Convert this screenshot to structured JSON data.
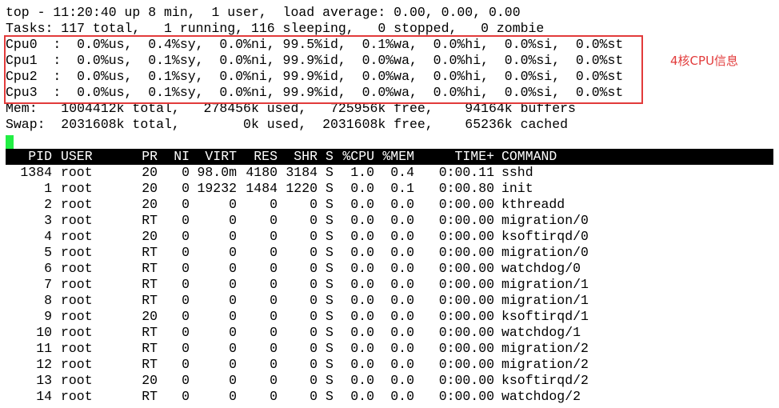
{
  "summary": {
    "top": "top - 11:20:40 up 8 min,  1 user,  load average: 0.00, 0.00, 0.00",
    "tasks": "Tasks: 117 total,   1 running, 116 sleeping,   0 stopped,   0 zombie",
    "cpus": [
      "Cpu0  :  0.0%us,  0.4%sy,  0.0%ni, 99.5%id,  0.1%wa,  0.0%hi,  0.0%si,  0.0%st",
      "Cpu1  :  0.0%us,  0.1%sy,  0.0%ni, 99.9%id,  0.0%wa,  0.0%hi,  0.0%si,  0.0%st",
      "Cpu2  :  0.0%us,  0.1%sy,  0.0%ni, 99.9%id,  0.0%wa,  0.0%hi,  0.0%si,  0.0%st",
      "Cpu3  :  0.0%us,  0.1%sy,  0.0%ni, 99.9%id,  0.0%wa,  0.0%hi,  0.0%si,  0.0%st"
    ],
    "mem": "Mem:   1004412k total,   278456k used,   725956k free,    94164k buffers",
    "swap": "Swap:  2031608k total,        0k used,  2031608k free,    65236k cached"
  },
  "annotation": {
    "text": "4核CPU信息",
    "color": "#e23b3b"
  },
  "columns": [
    "PID",
    "USER",
    "PR",
    "NI",
    "VIRT",
    "RES",
    "SHR",
    "S",
    "%CPU",
    "%MEM",
    "TIME+",
    "COMMAND"
  ],
  "processes": [
    {
      "pid": "1384",
      "user": "root",
      "pr": "20",
      "ni": "0",
      "virt": "98.0m",
      "res": "4180",
      "shr": "3184",
      "s": "S",
      "cpu": "1.0",
      "mem": "0.4",
      "time": "0:00.11",
      "cmd": "sshd"
    },
    {
      "pid": "1",
      "user": "root",
      "pr": "20",
      "ni": "0",
      "virt": "19232",
      "res": "1484",
      "shr": "1220",
      "s": "S",
      "cpu": "0.0",
      "mem": "0.1",
      "time": "0:00.80",
      "cmd": "init"
    },
    {
      "pid": "2",
      "user": "root",
      "pr": "20",
      "ni": "0",
      "virt": "0",
      "res": "0",
      "shr": "0",
      "s": "S",
      "cpu": "0.0",
      "mem": "0.0",
      "time": "0:00.00",
      "cmd": "kthreadd"
    },
    {
      "pid": "3",
      "user": "root",
      "pr": "RT",
      "ni": "0",
      "virt": "0",
      "res": "0",
      "shr": "0",
      "s": "S",
      "cpu": "0.0",
      "mem": "0.0",
      "time": "0:00.00",
      "cmd": "migration/0"
    },
    {
      "pid": "4",
      "user": "root",
      "pr": "20",
      "ni": "0",
      "virt": "0",
      "res": "0",
      "shr": "0",
      "s": "S",
      "cpu": "0.0",
      "mem": "0.0",
      "time": "0:00.00",
      "cmd": "ksoftirqd/0"
    },
    {
      "pid": "5",
      "user": "root",
      "pr": "RT",
      "ni": "0",
      "virt": "0",
      "res": "0",
      "shr": "0",
      "s": "S",
      "cpu": "0.0",
      "mem": "0.0",
      "time": "0:00.00",
      "cmd": "migration/0"
    },
    {
      "pid": "6",
      "user": "root",
      "pr": "RT",
      "ni": "0",
      "virt": "0",
      "res": "0",
      "shr": "0",
      "s": "S",
      "cpu": "0.0",
      "mem": "0.0",
      "time": "0:00.00",
      "cmd": "watchdog/0"
    },
    {
      "pid": "7",
      "user": "root",
      "pr": "RT",
      "ni": "0",
      "virt": "0",
      "res": "0",
      "shr": "0",
      "s": "S",
      "cpu": "0.0",
      "mem": "0.0",
      "time": "0:00.00",
      "cmd": "migration/1"
    },
    {
      "pid": "8",
      "user": "root",
      "pr": "RT",
      "ni": "0",
      "virt": "0",
      "res": "0",
      "shr": "0",
      "s": "S",
      "cpu": "0.0",
      "mem": "0.0",
      "time": "0:00.00",
      "cmd": "migration/1"
    },
    {
      "pid": "9",
      "user": "root",
      "pr": "20",
      "ni": "0",
      "virt": "0",
      "res": "0",
      "shr": "0",
      "s": "S",
      "cpu": "0.0",
      "mem": "0.0",
      "time": "0:00.00",
      "cmd": "ksoftirqd/1"
    },
    {
      "pid": "10",
      "user": "root",
      "pr": "RT",
      "ni": "0",
      "virt": "0",
      "res": "0",
      "shr": "0",
      "s": "S",
      "cpu": "0.0",
      "mem": "0.0",
      "time": "0:00.00",
      "cmd": "watchdog/1"
    },
    {
      "pid": "11",
      "user": "root",
      "pr": "RT",
      "ni": "0",
      "virt": "0",
      "res": "0",
      "shr": "0",
      "s": "S",
      "cpu": "0.0",
      "mem": "0.0",
      "time": "0:00.00",
      "cmd": "migration/2"
    },
    {
      "pid": "12",
      "user": "root",
      "pr": "RT",
      "ni": "0",
      "virt": "0",
      "res": "0",
      "shr": "0",
      "s": "S",
      "cpu": "0.0",
      "mem": "0.0",
      "time": "0:00.00",
      "cmd": "migration/2"
    },
    {
      "pid": "13",
      "user": "root",
      "pr": "20",
      "ni": "0",
      "virt": "0",
      "res": "0",
      "shr": "0",
      "s": "S",
      "cpu": "0.0",
      "mem": "0.0",
      "time": "0:00.00",
      "cmd": "ksoftirqd/2"
    },
    {
      "pid": "14",
      "user": "root",
      "pr": "RT",
      "ni": "0",
      "virt": "0",
      "res": "0",
      "shr": "0",
      "s": "S",
      "cpu": "0.0",
      "mem": "0.0",
      "time": "0:00.00",
      "cmd": "watchdog/2"
    }
  ]
}
